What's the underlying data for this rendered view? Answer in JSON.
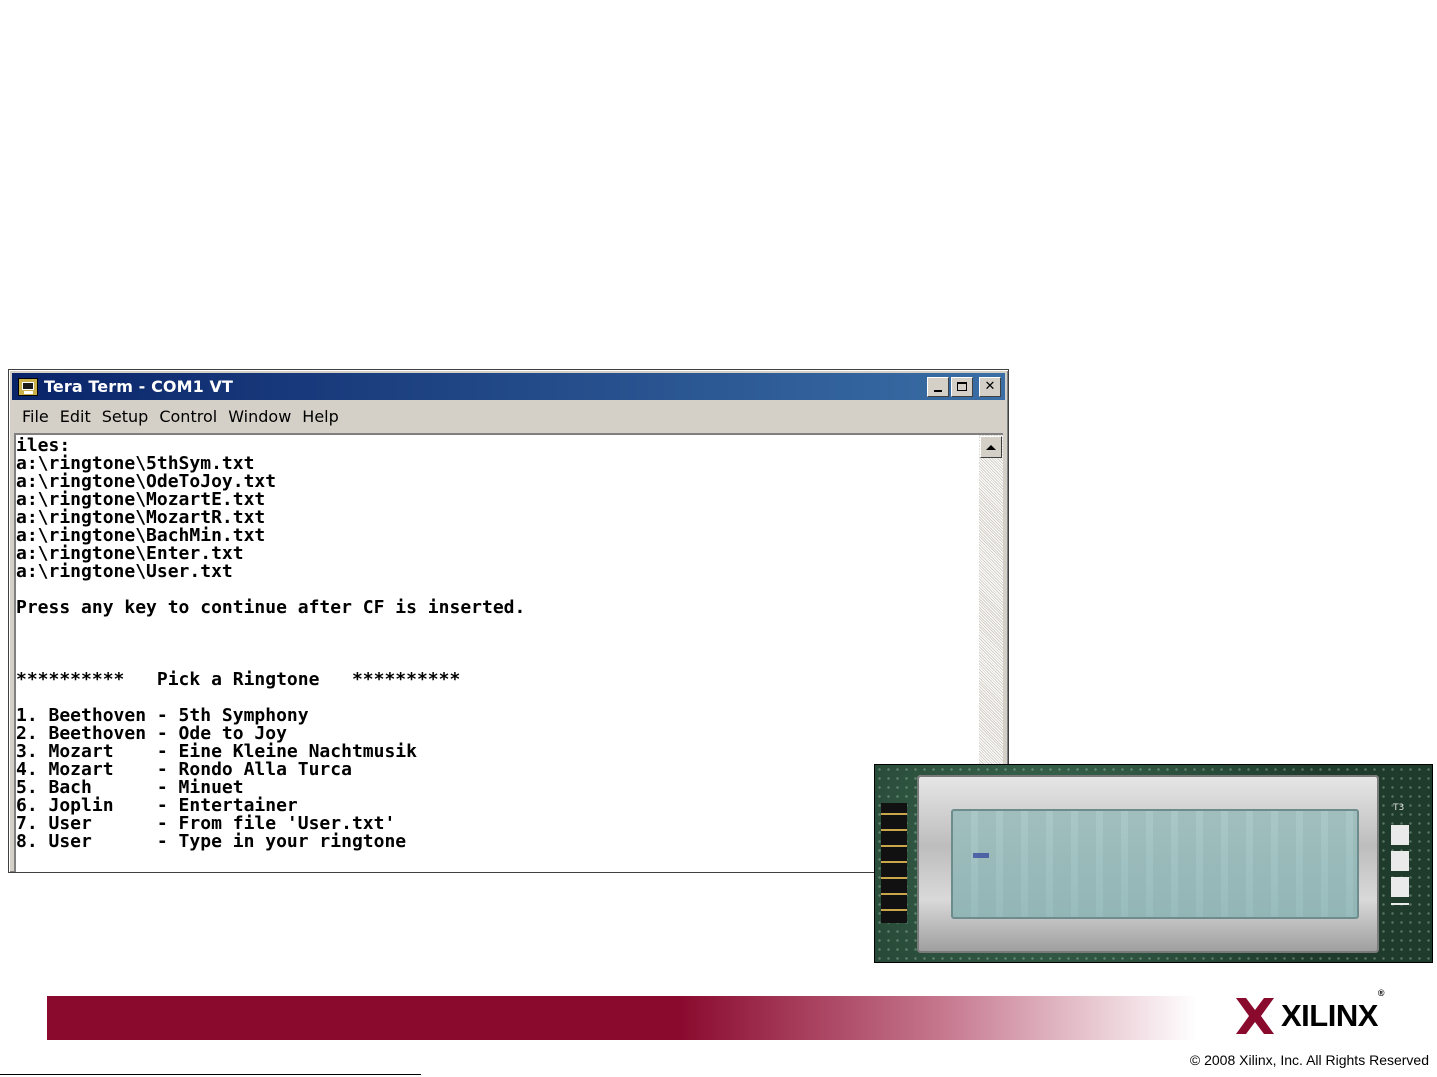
{
  "window": {
    "title": "Tera Term - COM1 VT",
    "controls": {
      "minimize": "minimize",
      "maximize": "maximize",
      "close": "✕"
    }
  },
  "menu": [
    "File",
    "Edit",
    "Setup",
    "Control",
    "Window",
    "Help"
  ],
  "terminal": {
    "lines": [
      "iles:",
      "a:\\ringtone\\5thSym.txt",
      "a:\\ringtone\\OdeToJoy.txt",
      "a:\\ringtone\\MozartE.txt",
      "a:\\ringtone\\MozartR.txt",
      "a:\\ringtone\\BachMin.txt",
      "a:\\ringtone\\Enter.txt",
      "a:\\ringtone\\User.txt",
      "",
      "Press any key to continue after CF is inserted.",
      "",
      "",
      "",
      "**********   Pick a Ringtone   **********",
      "",
      "1. Beethoven - 5th Symphony",
      "2. Beethoven - Ode to Joy",
      "3. Mozart    - Eine Kleine Nachtmusik",
      "4. Mozart    - Rondo Alla Turca",
      "5. Bach      - Minuet",
      "6. Joplin    - Entertainer",
      "7. User      - From file 'User.txt'",
      "8. User      - Type in your ringtone"
    ]
  },
  "photo": {
    "board_label": "T3"
  },
  "footer": {
    "logo_text": "XILINX",
    "registered": "®",
    "copyright": "© 2008 Xilinx, Inc. All Rights Reserved"
  },
  "colors": {
    "banner": "#8a0a2e",
    "titlebar": "#0a246a"
  }
}
